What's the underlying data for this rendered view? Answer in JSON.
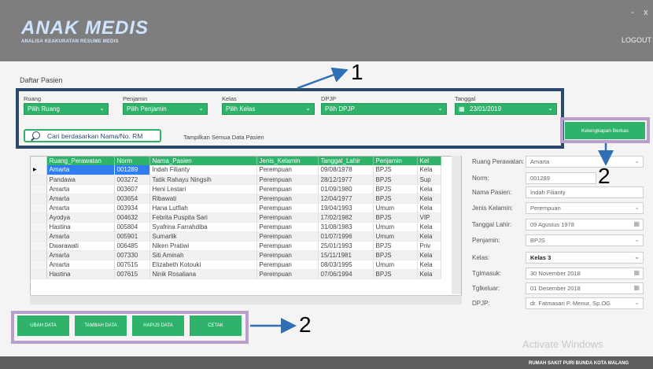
{
  "header": {
    "logo": "ANAK MEDIS",
    "subtitle": "ANALISA KEAKURATAN RESUME MEDIS",
    "logout_label": "LOGOUT",
    "minimize_label": "-",
    "close_label": "x"
  },
  "section_title": "Daftar Pasien",
  "filters": {
    "ruang": {
      "label": "Ruang",
      "value": "Pilih Ruang"
    },
    "penjamin": {
      "label": "Penjamin",
      "value": "Pilih Penjamin"
    },
    "kelas": {
      "label": "Kelas",
      "value": "Pilih Kelas"
    },
    "dpjp": {
      "label": "DPJP",
      "value": "Pilih DPJP"
    },
    "tanggal": {
      "label": "Tanggal",
      "value": "23/01/2019"
    },
    "search_placeholder": "Cari berdasarkan Nama/No. RM",
    "show_all_label": "Tampilkan Semua Data Pasien"
  },
  "kelengkapan_label": "Kelengkapan Berkas",
  "table": {
    "columns": [
      "Ruang_Perawatan",
      "Norm",
      "Nama_Pasien",
      "Jenis_Kelamin",
      "Tanggal_Lahir",
      "Penjamin",
      "Kel"
    ],
    "rows": [
      [
        "Amarta",
        "001289",
        "Indah Filianty",
        "Perempuan",
        "09/08/1978",
        "BPJS",
        "Kela"
      ],
      [
        "Pandawa",
        "003272",
        "Tatik Rahayu Ningsih",
        "Perempuan",
        "28/12/1977",
        "BPJS",
        "Sup"
      ],
      [
        "Amarta",
        "003607",
        "Heni Lestari",
        "Perempuan",
        "01/09/1980",
        "BPJS",
        "Kela"
      ],
      [
        "Amarta",
        "003654",
        "Ribawati",
        "Perempuan",
        "12/04/1977",
        "BPJS",
        "Kela"
      ],
      [
        "Amarta",
        "003934",
        "Hana Lutfiah",
        "Perempuan",
        "19/04/1993",
        "Umum",
        "Kela"
      ],
      [
        "Ayodya",
        "004632",
        "Febrita Puspita Sari",
        "Perempuan",
        "17/02/1982",
        "BPJS",
        "VIP"
      ],
      [
        "Hastina",
        "005804",
        "Syafrina Farrahdiba",
        "Perempuan",
        "31/08/1983",
        "Umum",
        "Kela"
      ],
      [
        "Amarta",
        "005901",
        "Sumarlik",
        "Perempuan",
        "01/07/1996",
        "Umum",
        "Kela"
      ],
      [
        "Dwarawati",
        "006485",
        "Niken Pratiwi",
        "Perempuan",
        "25/01/1993",
        "BPJS",
        "Priv"
      ],
      [
        "Amarta",
        "007330",
        "Siti Aminah",
        "Perempuan",
        "15/11/1981",
        "BPJS",
        "Kela"
      ],
      [
        "Amarta",
        "007515",
        "Elizabeth Kotouki",
        "Perempuan",
        "08/03/1995",
        "Umum",
        "Kela"
      ],
      [
        "Hastina",
        "007615",
        "Ninik Rosaliana",
        "Perempuan",
        "07/06/1994",
        "BPJS",
        "Kela"
      ]
    ]
  },
  "detail": {
    "ruang_perawatan": {
      "label": "Ruang Perawatan:",
      "value": "Amarta"
    },
    "norm": {
      "label": "Norm:",
      "value": "001289"
    },
    "nama_pasien": {
      "label": "Nama Pasien:",
      "value": "Indah Filianty"
    },
    "jenis_kelamin": {
      "label": "Jenis Kelamin:",
      "value": "Perempuan"
    },
    "tanggal_lahir": {
      "label": "Tanggal Lahir:",
      "value": "09  Agustus  1978"
    },
    "penjamin": {
      "label": "Penjamin:",
      "value": "BPJS"
    },
    "kelas": {
      "label": "Kelas:",
      "value": "Kelas 3"
    },
    "tglmasuk": {
      "label": "Tglmasuk:",
      "value": "30  November  2018"
    },
    "tglkeluar": {
      "label": "Tglkeluar:",
      "value": "01  Desember  2018"
    },
    "dpjp": {
      "label": "DPJP:",
      "value": "dr. Fatmasari P. Menur, Sp.OG"
    }
  },
  "buttons": {
    "ubah": "UBAH DATA",
    "tambah": "TAMBAH DATA",
    "hapus": "HAPUS DATA",
    "cetak": "CETAK"
  },
  "annotations": {
    "label_1": "1",
    "label_2a": "2",
    "label_2b": "2"
  },
  "footer_text": "RUMAH SAKIT PURI BUNDA KOTA MALANG",
  "watermark": "Activate Windows"
}
